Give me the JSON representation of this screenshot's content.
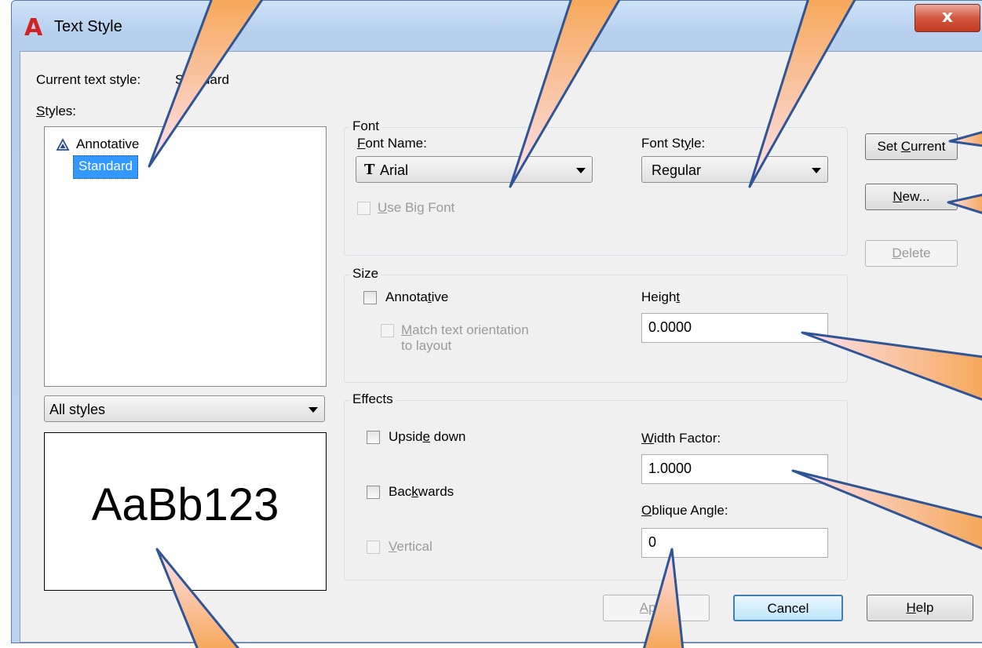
{
  "window": {
    "title": "Text Style",
    "app_icon": "autocad-a-icon",
    "close_glyph": "x"
  },
  "current_style": {
    "label": "Current text style:",
    "value": "Standard"
  },
  "styles": {
    "label": "Styles:",
    "items": [
      {
        "label": "Annotative",
        "icon": "annotative-icon",
        "selected": false
      },
      {
        "label": "Standard",
        "selected": true
      }
    ],
    "filter": {
      "value": "All styles"
    }
  },
  "preview": {
    "text": "AaBb123"
  },
  "font_group": {
    "title": "Font",
    "font_name": {
      "label": "Font Name:",
      "value": "Arial",
      "icon": "truetype-icon"
    },
    "font_style": {
      "label": "Font Style:",
      "value": "Regular"
    },
    "use_big_font": {
      "label": "Use Big Font",
      "checked": false,
      "enabled": false
    }
  },
  "size_group": {
    "title": "Size",
    "annotative": {
      "label": "Annotative",
      "checked": false
    },
    "match_orientation": {
      "label_line1": "Match text orientation",
      "label_line2": "to layout",
      "checked": false,
      "enabled": false
    },
    "height": {
      "label": "Height",
      "value": "0.0000"
    }
  },
  "effects_group": {
    "title": "Effects",
    "upside_down": {
      "label": "Upside down",
      "checked": false
    },
    "backwards": {
      "label": "Backwards",
      "checked": false
    },
    "vertical": {
      "label": "Vertical",
      "checked": false,
      "enabled": false
    },
    "width_factor": {
      "label": "Width Factor:",
      "value": "1.0000"
    },
    "oblique_angle": {
      "label": "Oblique Angle:",
      "value": "0"
    }
  },
  "side_buttons": {
    "set_current": "Set Current",
    "new": "New...",
    "delete": "Delete"
  },
  "bottom_buttons": {
    "apply": "Apply",
    "cancel": "Cancel",
    "help": "Help"
  },
  "colors": {
    "callout_stroke": "#2f5597",
    "callout_fill_light": "#fde2f0",
    "callout_fill_dark": "#f6a85a",
    "selection": "#3399ff"
  }
}
